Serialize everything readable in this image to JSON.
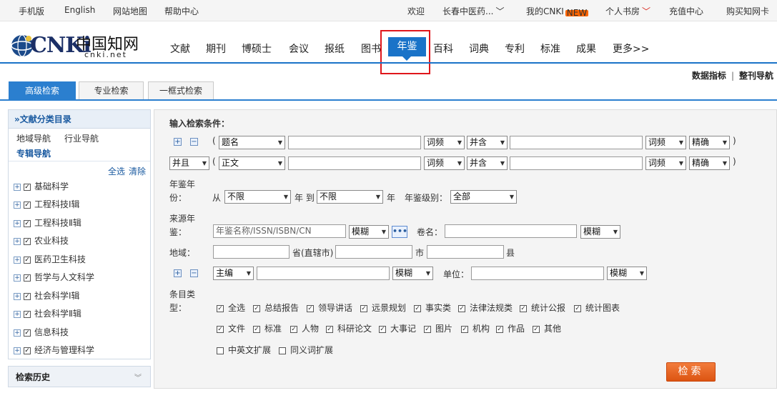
{
  "topbar": {
    "mobile": "手机版",
    "english": "English",
    "sitemap": "网站地图",
    "help": "帮助中心",
    "welcome": "欢迎",
    "user": "长春中医药...",
    "mycnki": "我的CNKI",
    "new_badge": "NEW",
    "bookroom": "个人书房",
    "recharge": "充值中心",
    "buycard": "购买知网卡"
  },
  "header": {
    "logo_latin": "CNKi",
    "logo_cn": "中国知网",
    "logo_url": "cnki.net",
    "nav": [
      "文献",
      "期刊",
      "博硕士",
      "会议",
      "报纸",
      "图书",
      "年鉴",
      "百科",
      "词典",
      "专利",
      "标准",
      "成果",
      "更多>>"
    ],
    "active_nav": "年鉴",
    "links": {
      "data_index": "数据指标",
      "sep": "|",
      "journal_nav": "整刊导航"
    }
  },
  "tabs": [
    "高级检索",
    "专业检索",
    "一框式检索"
  ],
  "sidebar": {
    "title": "»文献分类目录",
    "nav_links": [
      "地域导航",
      "行业导航",
      "专辑导航"
    ],
    "select_all": "全选",
    "clear": "清除",
    "categories": [
      "基础科学",
      "工程科技Ⅰ辑",
      "工程科技Ⅱ辑",
      "农业科技",
      "医药卫生科技",
      "哲学与人文科学",
      "社会科学Ⅰ辑",
      "社会科学Ⅱ辑",
      "信息科技",
      "经济与管理科学"
    ],
    "history": "检索历史",
    "history_icon": "double-chevron-down-icon"
  },
  "form": {
    "heading": "输入检索条件：",
    "plus": "+",
    "minus": "−",
    "paren_open": "(",
    "paren_close": ")",
    "row1": {
      "field": "题名",
      "freq1": "词频",
      "logic": "并含",
      "freq2": "词频",
      "match": "精确"
    },
    "row2": {
      "bool": "并且",
      "field": "正文",
      "freq1": "词频",
      "logic": "并含",
      "freq2": "词频",
      "match": "精确"
    },
    "year": {
      "label1": "年鉴年",
      "label2": "份：",
      "from": "从",
      "from_value": "不限",
      "year_to": "年 到",
      "to_value": "不限",
      "year": "年",
      "level_label": "年鉴级别：",
      "level_value": "全部"
    },
    "source": {
      "label1": "来源年",
      "label2": "鉴：",
      "placeholder": "年鉴名称/ISSN/ISBN/CN",
      "match": "模糊",
      "dots": "•••",
      "volume_label": "卷名：",
      "volume_match": "模糊"
    },
    "region": {
      "label": "地域：",
      "province": "省(直辖市)",
      "city": "市",
      "county": "县"
    },
    "editor": {
      "field": "主编",
      "match": "模糊",
      "unit_label": "单位：",
      "unit_match": "模糊"
    },
    "entry": {
      "label1": "条目类",
      "label2": "型：",
      "row1": [
        "全选",
        "总结报告",
        "领导讲话",
        "远景规划",
        "事实类",
        "法律法规类",
        "统计公报",
        "统计图表"
      ],
      "row2": [
        "文件",
        "标准",
        "人物",
        "科研论文",
        "大事记",
        "图片",
        "机构",
        "作品",
        "其他"
      ],
      "ext": [
        "中英文扩展",
        "同义词扩展"
      ]
    },
    "search_button": "检索"
  }
}
